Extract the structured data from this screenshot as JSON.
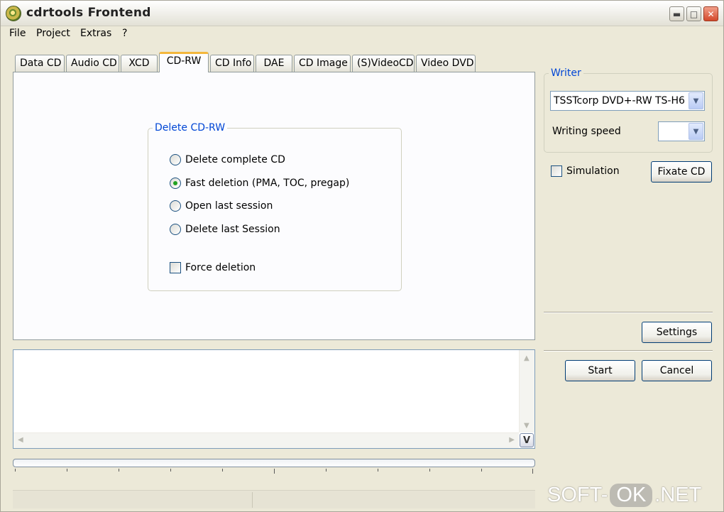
{
  "window": {
    "title": "cdrtools Frontend",
    "icon": "cd-disc-icon"
  },
  "menu": [
    "File",
    "Project",
    "Extras",
    "?"
  ],
  "tabs": [
    {
      "label": "Data CD",
      "active": false
    },
    {
      "label": "Audio CD",
      "active": false
    },
    {
      "label": "XCD",
      "active": false
    },
    {
      "label": "CD-RW",
      "active": true
    },
    {
      "label": "CD Info",
      "active": false
    },
    {
      "label": "DAE",
      "active": false
    },
    {
      "label": "CD Image",
      "active": false
    },
    {
      "label": "(S)VideoCD",
      "active": false
    },
    {
      "label": "Video DVD",
      "active": false
    }
  ],
  "delete_group": {
    "legend": "Delete CD-RW",
    "options": [
      {
        "label": "Delete complete CD",
        "checked": false
      },
      {
        "label": "Fast deletion (PMA, TOC, pregap)",
        "checked": true
      },
      {
        "label": "Open last session",
        "checked": false
      },
      {
        "label": "Delete last Session",
        "checked": false
      }
    ],
    "force_deletion": {
      "label": "Force deletion",
      "checked": false
    }
  },
  "log": {
    "lines": [],
    "toggle_label": "V"
  },
  "progress": {
    "value": 0
  },
  "writer": {
    "legend": "Writer",
    "device": "TSSTcorp DVD+-RW TS-H6",
    "speed_label": "Writing speed",
    "speed_value": ""
  },
  "simulation": {
    "label": "Simulation",
    "checked": false
  },
  "buttons": {
    "fixate": "Fixate CD",
    "settings": "Settings",
    "start": "Start",
    "cancel": "Cancel"
  },
  "watermark": {
    "left": "SOFT-",
    "badge": "OK",
    "right": ".NET"
  },
  "colors": {
    "accent": "#0046d5",
    "tab_highlight": "#f4b73c",
    "window": "#ece9d8"
  }
}
